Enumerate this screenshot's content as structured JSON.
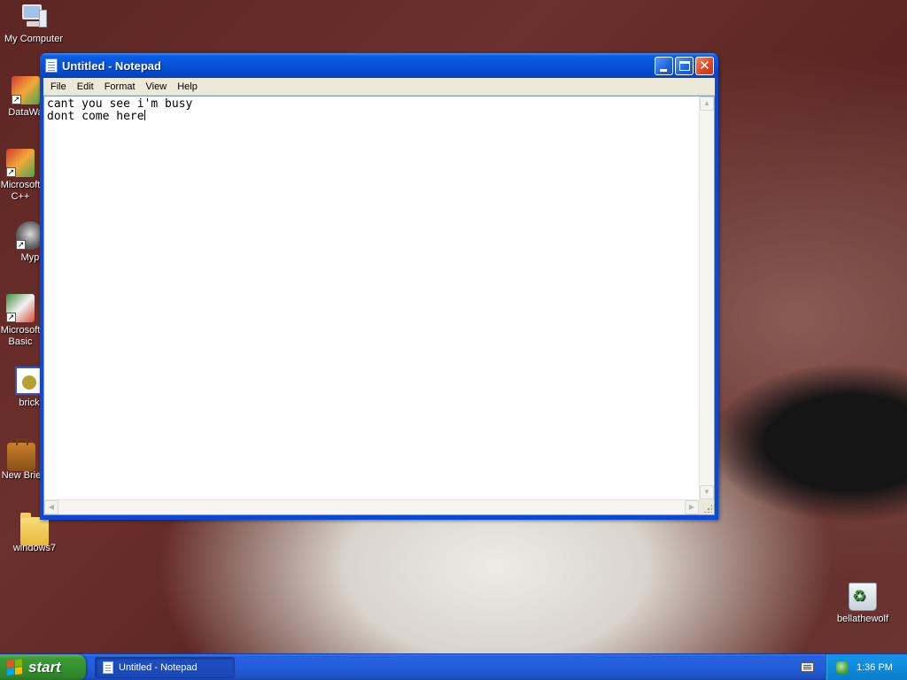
{
  "desktop": {
    "icons": [
      {
        "label": "My Computer",
        "icon": "my-computer-icon"
      },
      {
        "label": "DataWa",
        "icon": "datawa-shortcut-icon"
      },
      {
        "label": "Microsoft\nC++",
        "icon": "visual-cpp-shortcut-icon"
      },
      {
        "label": "Myp",
        "icon": "raccoon-shortcut-icon"
      },
      {
        "label": "Microsoft\nBasic",
        "icon": "visual-basic-shortcut-icon"
      },
      {
        "label": "brick",
        "icon": "brick-app-icon"
      },
      {
        "label": "New Brie",
        "icon": "briefcase-icon"
      },
      {
        "label": "windows7",
        "icon": "folder-icon"
      },
      {
        "label": "bellathewolf",
        "icon": "recycle-bin-icon"
      }
    ]
  },
  "notepad": {
    "title": "Untitled - Notepad",
    "menu": [
      "File",
      "Edit",
      "Format",
      "View",
      "Help"
    ],
    "text_line_1": "cant you see i'm busy",
    "text_line_2": "dont come here"
  },
  "taskbar": {
    "start_label": "start",
    "task_label": "Untitled - Notepad",
    "clock": "1:36 PM"
  },
  "colors": {
    "titlebar": "#0552d9",
    "taskbar": "#245edb",
    "start": "#36912f",
    "tray": "#0d8bdb"
  }
}
